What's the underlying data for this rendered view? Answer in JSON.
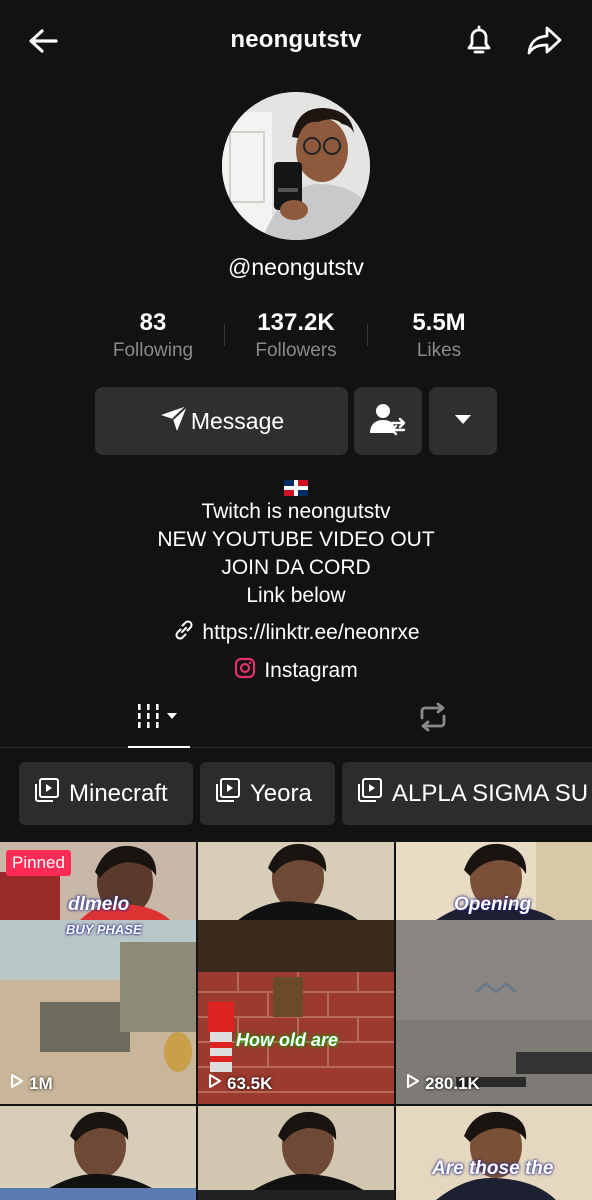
{
  "header": {
    "title": "neongutstv",
    "icons": [
      "back-arrow-icon",
      "bell-icon",
      "share-icon"
    ]
  },
  "profile": {
    "handle": "@neongutstv",
    "stats": [
      {
        "value": "83",
        "label": "Following"
      },
      {
        "value": "137.2K",
        "label": "Followers"
      },
      {
        "value": "5.5M",
        "label": "Likes"
      }
    ]
  },
  "actions": {
    "message_label": "Message",
    "icons": [
      "paper-plane-icon",
      "add-friend-icon",
      "chevron-down-icon"
    ]
  },
  "bio": {
    "flag": "dominican-republic-flag",
    "lines": [
      "Twitch is neongutstv",
      "NEW YOUTUBE VIDEO OUT",
      "JOIN DA CORD",
      "Link below"
    ],
    "link": "https://linktr.ee/neonrxe",
    "instagram_label": "Instagram"
  },
  "tabs": [
    "videos-grid-icon",
    "reposts-icon"
  ],
  "playlists": [
    "Minecraft",
    "Yeora",
    "ALPLA SIGMA SU"
  ],
  "videos": [
    {
      "pinned_label": "Pinned",
      "caption_top": "dlmelo",
      "caption_banner": "BUY PHASE",
      "views": "1M"
    },
    {
      "caption_bottom": "How old are",
      "views": "63.5K"
    },
    {
      "caption_top": "Opening",
      "views": "280.1K"
    },
    {
      "caption_bottom": "Are those the"
    }
  ],
  "colors": {
    "background": "#121212",
    "button": "#2f2f2f",
    "pinned": "#fe2c55",
    "instagram": "#e1306c"
  }
}
